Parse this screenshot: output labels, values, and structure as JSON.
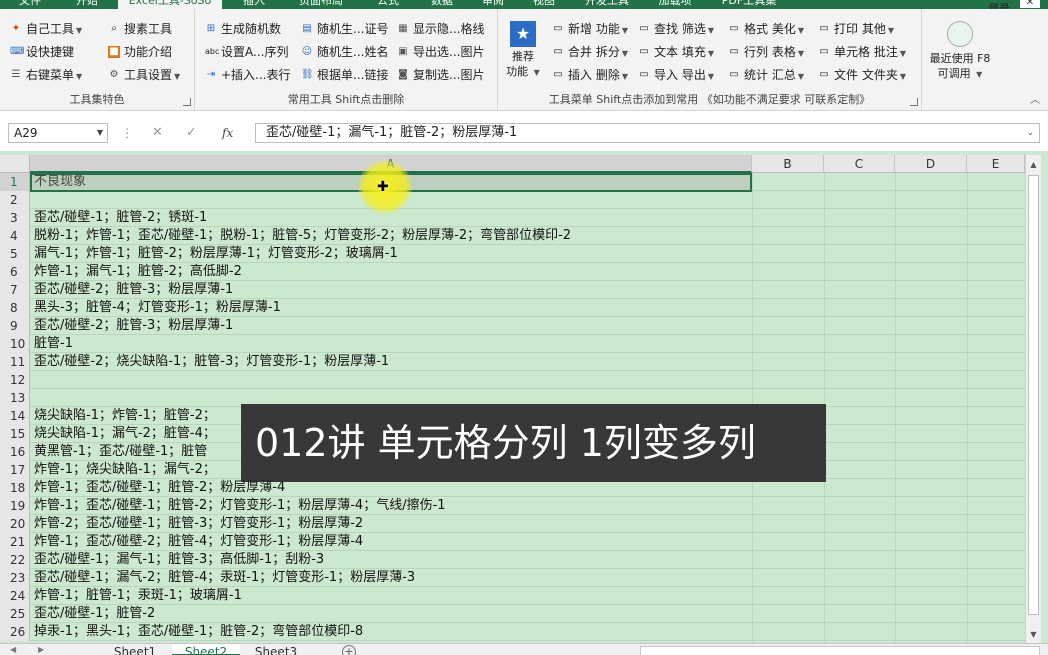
{
  "title_bar": {
    "tabs": [
      "文件",
      "开始",
      "Excel工具-SoSo",
      "插入",
      "页面布局",
      "公式",
      "数据",
      "审阅",
      "视图",
      "开发工具",
      "加载项",
      "PDF工具集"
    ],
    "active_tab": "Excel工具-SoSo",
    "login": "登录"
  },
  "ribbon": {
    "groups": [
      {
        "label": "工具集特色",
        "items": [
          {
            "label": "自己工具",
            "icon": "sparkle-icon",
            "dd": true
          },
          {
            "label": "设快捷键",
            "icon": "keyboard-icon"
          },
          {
            "label": "右键菜单",
            "icon": "menu-icon",
            "dd": true
          },
          {
            "label": "搜素工具",
            "icon": "search-icon"
          },
          {
            "label": "功能介绍",
            "icon": "book-icon"
          },
          {
            "label": "工具设置",
            "icon": "gear-icon",
            "dd": true
          }
        ]
      },
      {
        "label": "常用工具 Shift点击删除",
        "items": [
          {
            "label": "生成随机数",
            "icon": "random-icon"
          },
          {
            "label": "设置A...序列",
            "icon": "abc-icon"
          },
          {
            "label": "+插入...表行",
            "icon": "insert-row-icon"
          },
          {
            "label": "随机生...证号",
            "icon": "id-card-icon"
          },
          {
            "label": "随机生...姓名",
            "icon": "person-icon"
          },
          {
            "label": "根据单...链接",
            "icon": "link-icon"
          },
          {
            "label": "显示隐...格线",
            "icon": "grid-icon"
          },
          {
            "label": "导出选...图片",
            "icon": "image-export-icon"
          },
          {
            "label": "复制选...图片",
            "icon": "camera-icon"
          }
        ]
      },
      {
        "label": "工具菜单 Shift点击添加到常用 《如功能不满足要求 可联系定制》",
        "big_button": "推荐\n功能",
        "items": [
          {
            "label": "新增 功能",
            "icon": "new-folder-icon",
            "dd": true
          },
          {
            "label": "合并 拆分",
            "icon": "merge-folder-icon",
            "dd": true
          },
          {
            "label": "插入 删除",
            "icon": "insert-folder-icon",
            "dd": true
          },
          {
            "label": "查找 筛选",
            "icon": "find-folder-icon",
            "dd": true
          },
          {
            "label": "文本 填充",
            "icon": "text-folder-icon",
            "dd": true
          },
          {
            "label": "导入 导出",
            "icon": "import-folder-icon",
            "dd": true
          },
          {
            "label": "格式 美化",
            "icon": "format-folder-icon",
            "dd": true
          },
          {
            "label": "行列 表格",
            "icon": "table-folder-icon",
            "dd": true
          },
          {
            "label": "统计 汇总",
            "icon": "stats-folder-icon",
            "dd": true
          },
          {
            "label": "打印 其他",
            "icon": "print-folder-icon",
            "dd": true
          },
          {
            "label": "单元格 批注",
            "icon": "cell-folder-icon",
            "dd": true
          },
          {
            "label": "文件 文件夹",
            "icon": "file-folder-icon",
            "dd": true
          }
        ]
      },
      {
        "label": "",
        "big_button": "最近使用 F8\n功能",
        "recent_label_a": "最近使用",
        "recent_label_b": "F8",
        "recent_label_c": "可调用"
      }
    ]
  },
  "formula_bar": {
    "name_box": "A29",
    "formula": "歪芯/碰壁-1；漏气-1；脏管-2；粉层厚薄-1"
  },
  "columns": [
    "A",
    "B",
    "C",
    "D",
    "E"
  ],
  "selected_column": "A",
  "rows": [
    {
      "n": "1",
      "text": "不良现象"
    },
    {
      "n": "2",
      "text": ""
    },
    {
      "n": "3",
      "text": "歪芯/碰壁-1；脏管-2；锈斑-1"
    },
    {
      "n": "4",
      "text": "脱粉-1；炸管-1；歪芯/碰壁-1；脱粉-1；脏管-5；灯管变形-2；粉层厚薄-2；弯管部位模印-2"
    },
    {
      "n": "5",
      "text": "漏气-1；炸管-1；脏管-2；粉层厚薄-1；灯管变形-2；玻璃屑-1"
    },
    {
      "n": "6",
      "text": "炸管-1；漏气-1；脏管-2；高低脚-2"
    },
    {
      "n": "7",
      "text": "歪芯/碰壁-2；脏管-3；粉层厚薄-1"
    },
    {
      "n": "8",
      "text": "黑头-3；脏管-4；灯管变形-1；粉层厚薄-1"
    },
    {
      "n": "9",
      "text": "歪芯/碰壁-2；脏管-3；粉层厚薄-1"
    },
    {
      "n": "10",
      "text": "脏管-1"
    },
    {
      "n": "11",
      "text": "歪芯/碰壁-2；烧尖缺陷-1；脏管-3；灯管变形-1；粉层厚薄-1"
    },
    {
      "n": "12",
      "text": ""
    },
    {
      "n": "13",
      "text": ""
    },
    {
      "n": "14",
      "text": "烧尖缺陷-1；炸管-1；脏管-2；"
    },
    {
      "n": "15",
      "text": "烧尖缺陷-1；漏气-2；脏管-4；"
    },
    {
      "n": "16",
      "text": "黄黑管-1；歪芯/碰壁-1；脏管"
    },
    {
      "n": "17",
      "text": "炸管-1；烧尖缺陷-1；漏气-2；"
    },
    {
      "n": "18",
      "text": "炸管-1；歪芯/碰壁-1；脏管-2；粉层厚薄-4"
    },
    {
      "n": "19",
      "text": "炸管-1；歪芯/碰壁-1；脏管-2；灯管变形-1；粉层厚薄-4；气线/擦伤-1"
    },
    {
      "n": "20",
      "text": "炸管-2；歪芯/碰壁-1；脏管-3；灯管变形-1；粉层厚薄-2"
    },
    {
      "n": "21",
      "text": "炸管-1；歪芯/碰壁-2；脏管-4；灯管变形-1；粉层厚薄-4"
    },
    {
      "n": "22",
      "text": "歪芯/碰壁-1；漏气-1；脏管-3；高低脚-1；刮粉-3"
    },
    {
      "n": "23",
      "text": "歪芯/碰壁-1；漏气-2；脏管-4；汞斑-1；灯管变形-1；粉层厚薄-3"
    },
    {
      "n": "24",
      "text": "炸管-1；脏管-1；汞斑-1；玻璃屑-1"
    },
    {
      "n": "25",
      "text": "歪芯/碰壁-1；脏管-2"
    },
    {
      "n": "26",
      "text": "掉汞-1；黑头-1；歪芯/碰壁-1；脏管-2；弯管部位模印-8"
    }
  ],
  "caption": "012讲 单元格分列 1列变多列",
  "sheets": [
    "Sheet1",
    "Sheet2",
    "Sheet3"
  ],
  "active_sheet": "Sheet2",
  "colors": {
    "accent": "#217346",
    "cell_bg": "#cce8cf"
  }
}
